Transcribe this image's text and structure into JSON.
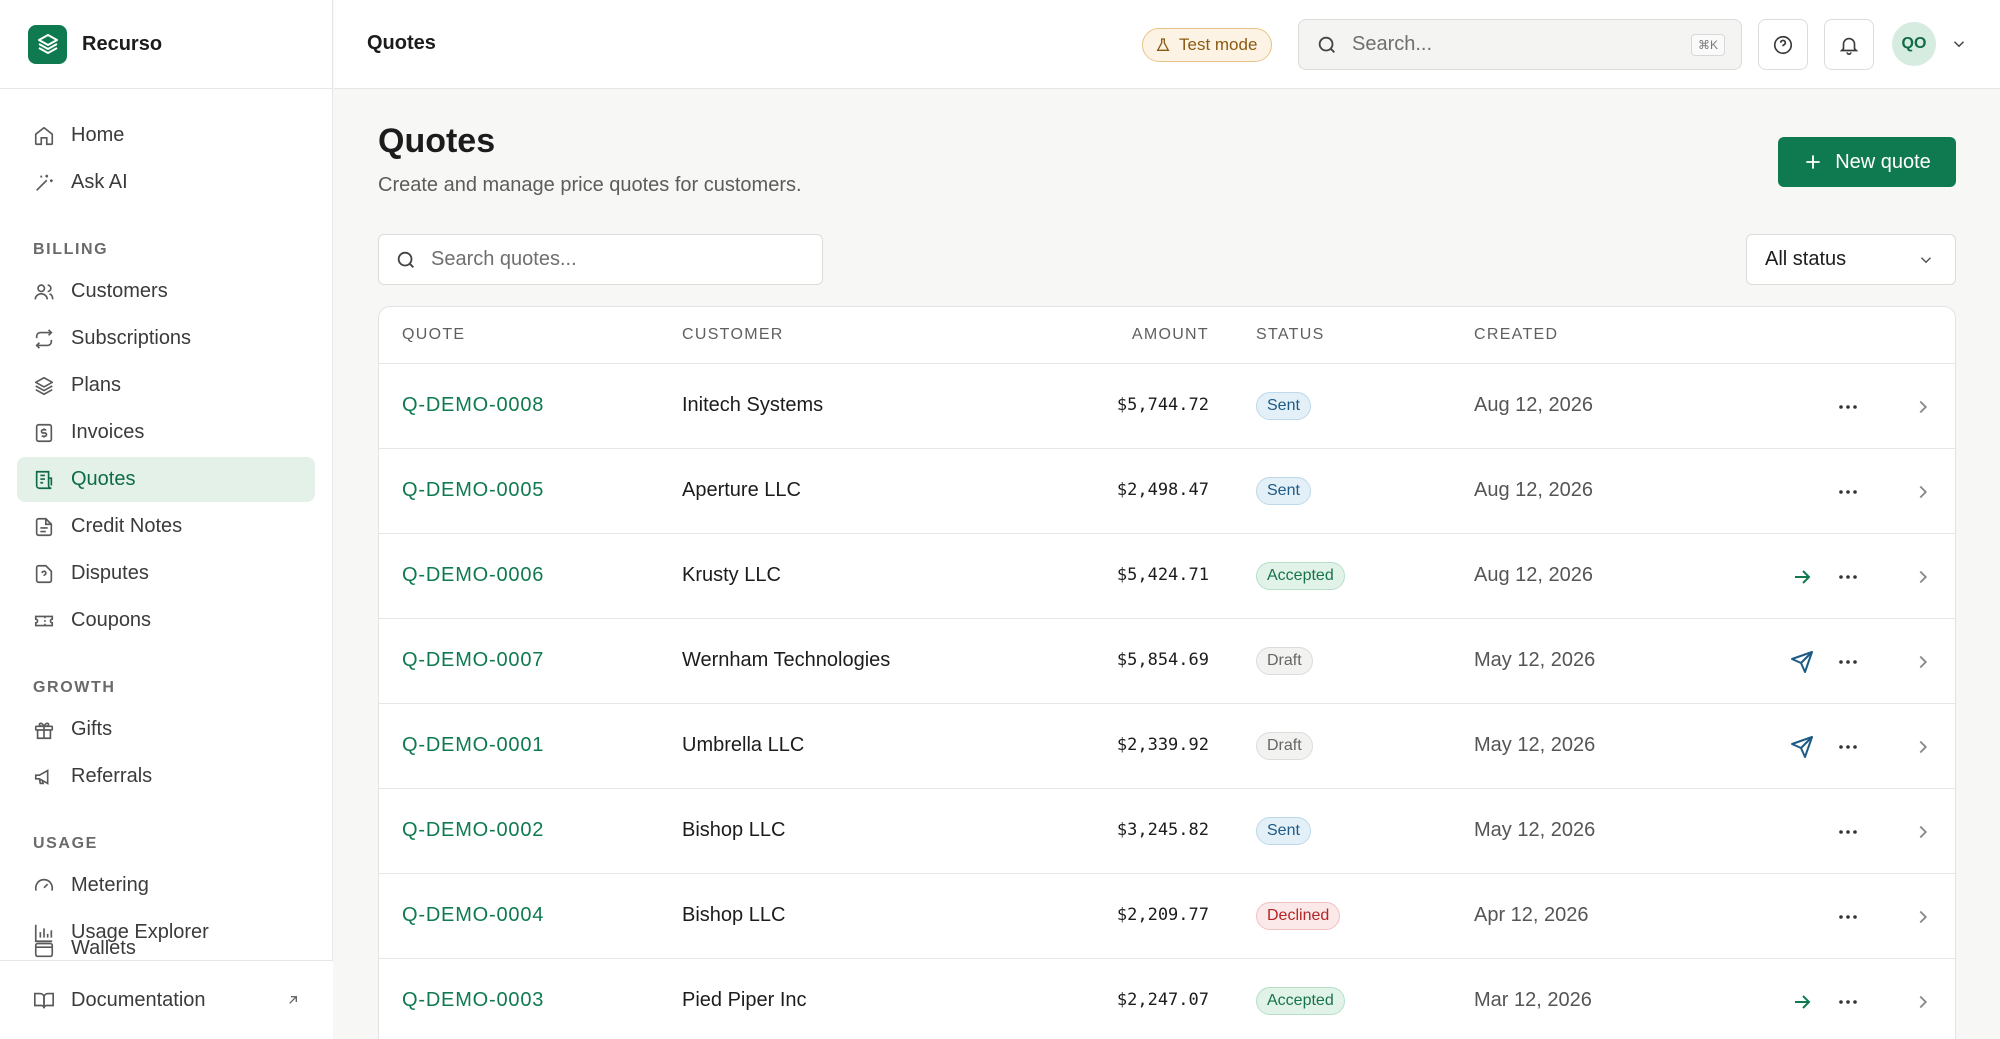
{
  "app": {
    "name": "Recurso"
  },
  "topbar": {
    "title": "Quotes",
    "test_mode_label": "Test mode",
    "search_placeholder": "Search...",
    "search_shortcut": "⌘K",
    "avatar_initials": "QO"
  },
  "sidebar": {
    "home": "Home",
    "ask_ai": "Ask AI",
    "billing_title": "BILLING",
    "billing": [
      "Customers",
      "Subscriptions",
      "Plans",
      "Invoices",
      "Quotes",
      "Credit Notes",
      "Disputes",
      "Coupons"
    ],
    "growth_title": "GROWTH",
    "growth": [
      "Gifts",
      "Referrals"
    ],
    "usage_title": "USAGE",
    "usage": [
      "Metering",
      "Usage Explorer",
      "Wallets"
    ],
    "footer": "Documentation",
    "active": "Quotes"
  },
  "page": {
    "title": "Quotes",
    "subtitle": "Create and manage price quotes for customers.",
    "new_button": "New quote",
    "search_placeholder": "Search quotes...",
    "status_filter": "All status"
  },
  "table": {
    "headers": {
      "quote": "QUOTE",
      "customer": "CUSTOMER",
      "amount": "AMOUNT",
      "status": "STATUS",
      "created": "CREATED"
    },
    "rows": [
      {
        "quote": "Q-DEMO-0008",
        "customer": "Initech Systems",
        "amount": "$5,744.72",
        "status": "Sent",
        "created": "Aug 12, 2026",
        "action": ""
      },
      {
        "quote": "Q-DEMO-0005",
        "customer": "Aperture LLC",
        "amount": "$2,498.47",
        "status": "Sent",
        "created": "Aug 12, 2026",
        "action": ""
      },
      {
        "quote": "Q-DEMO-0006",
        "customer": "Krusty LLC",
        "amount": "$5,424.71",
        "status": "Accepted",
        "created": "Aug 12, 2026",
        "action": "arrow-right-icon"
      },
      {
        "quote": "Q-DEMO-0007",
        "customer": "Wernham Technologies",
        "amount": "$5,854.69",
        "status": "Draft",
        "created": "May 12, 2026",
        "action": "send-icon"
      },
      {
        "quote": "Q-DEMO-0001",
        "customer": "Umbrella LLC",
        "amount": "$2,339.92",
        "status": "Draft",
        "created": "May 12, 2026",
        "action": "send-icon"
      },
      {
        "quote": "Q-DEMO-0002",
        "customer": "Bishop LLC",
        "amount": "$3,245.82",
        "status": "Sent",
        "created": "May 12, 2026",
        "action": ""
      },
      {
        "quote": "Q-DEMO-0004",
        "customer": "Bishop LLC",
        "amount": "$2,209.77",
        "status": "Declined",
        "created": "Apr 12, 2026",
        "action": ""
      },
      {
        "quote": "Q-DEMO-0003",
        "customer": "Pied Piper Inc",
        "amount": "$2,247.07",
        "status": "Accepted",
        "created": "Mar 12, 2026",
        "action": "arrow-right-icon"
      }
    ]
  },
  "colors": {
    "brand": "#0f7a4f",
    "send_action": "#1d5a85",
    "accept_action": "#0f7a4f"
  }
}
